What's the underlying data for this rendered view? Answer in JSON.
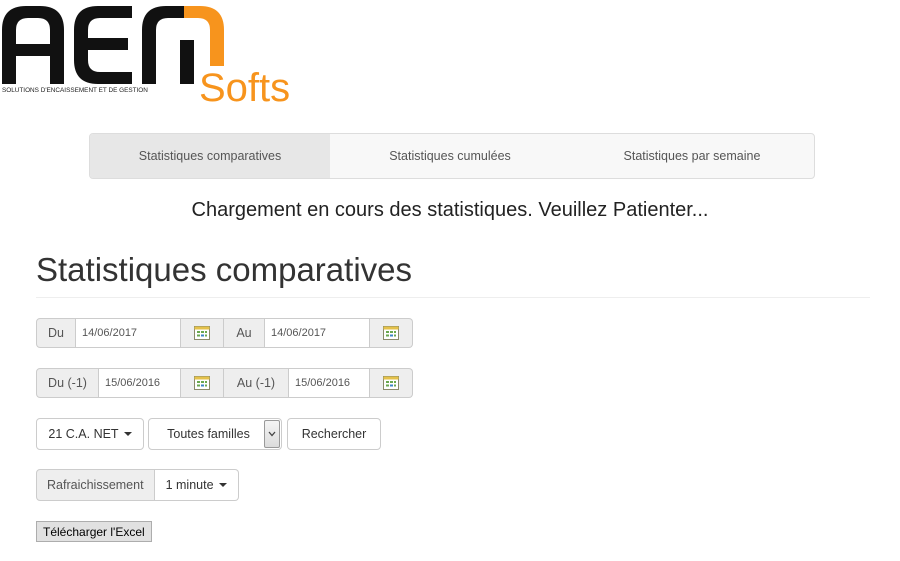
{
  "logo": {
    "main_text": "AEM",
    "tagline": "SOLUTIONS D'ENCAISSEMENT ET DE GESTION",
    "softs_text": "Softs",
    "colors": {
      "dark": "#111111",
      "accent": "#f7941d"
    }
  },
  "tabs": [
    {
      "label": "Statistiques comparatives",
      "active": true
    },
    {
      "label": "Statistiques cumulées",
      "active": false
    },
    {
      "label": "Statistiques par semaine",
      "active": false
    }
  ],
  "loading_message": "Chargement en cours des statistiques. Veuillez Patienter...",
  "heading": "Statistiques comparatives",
  "date_range": {
    "from_label": "Du",
    "from_value": "14/06/2017",
    "to_label": "Au",
    "to_value": "14/06/2017"
  },
  "prev_date_range": {
    "from_label": "Du (-1)",
    "from_value": "15/06/2016",
    "to_label": "Au (-1)",
    "to_value": "15/06/2016"
  },
  "calendar_icon": "calendar-icon",
  "filters": {
    "metric_label": "21 C.A. NET",
    "family_select": "Toutes familles",
    "search_label": "Rechercher"
  },
  "refresh": {
    "label": "Rafraichissement",
    "value": "1 minute"
  },
  "excel_button": "Télécharger l'Excel"
}
